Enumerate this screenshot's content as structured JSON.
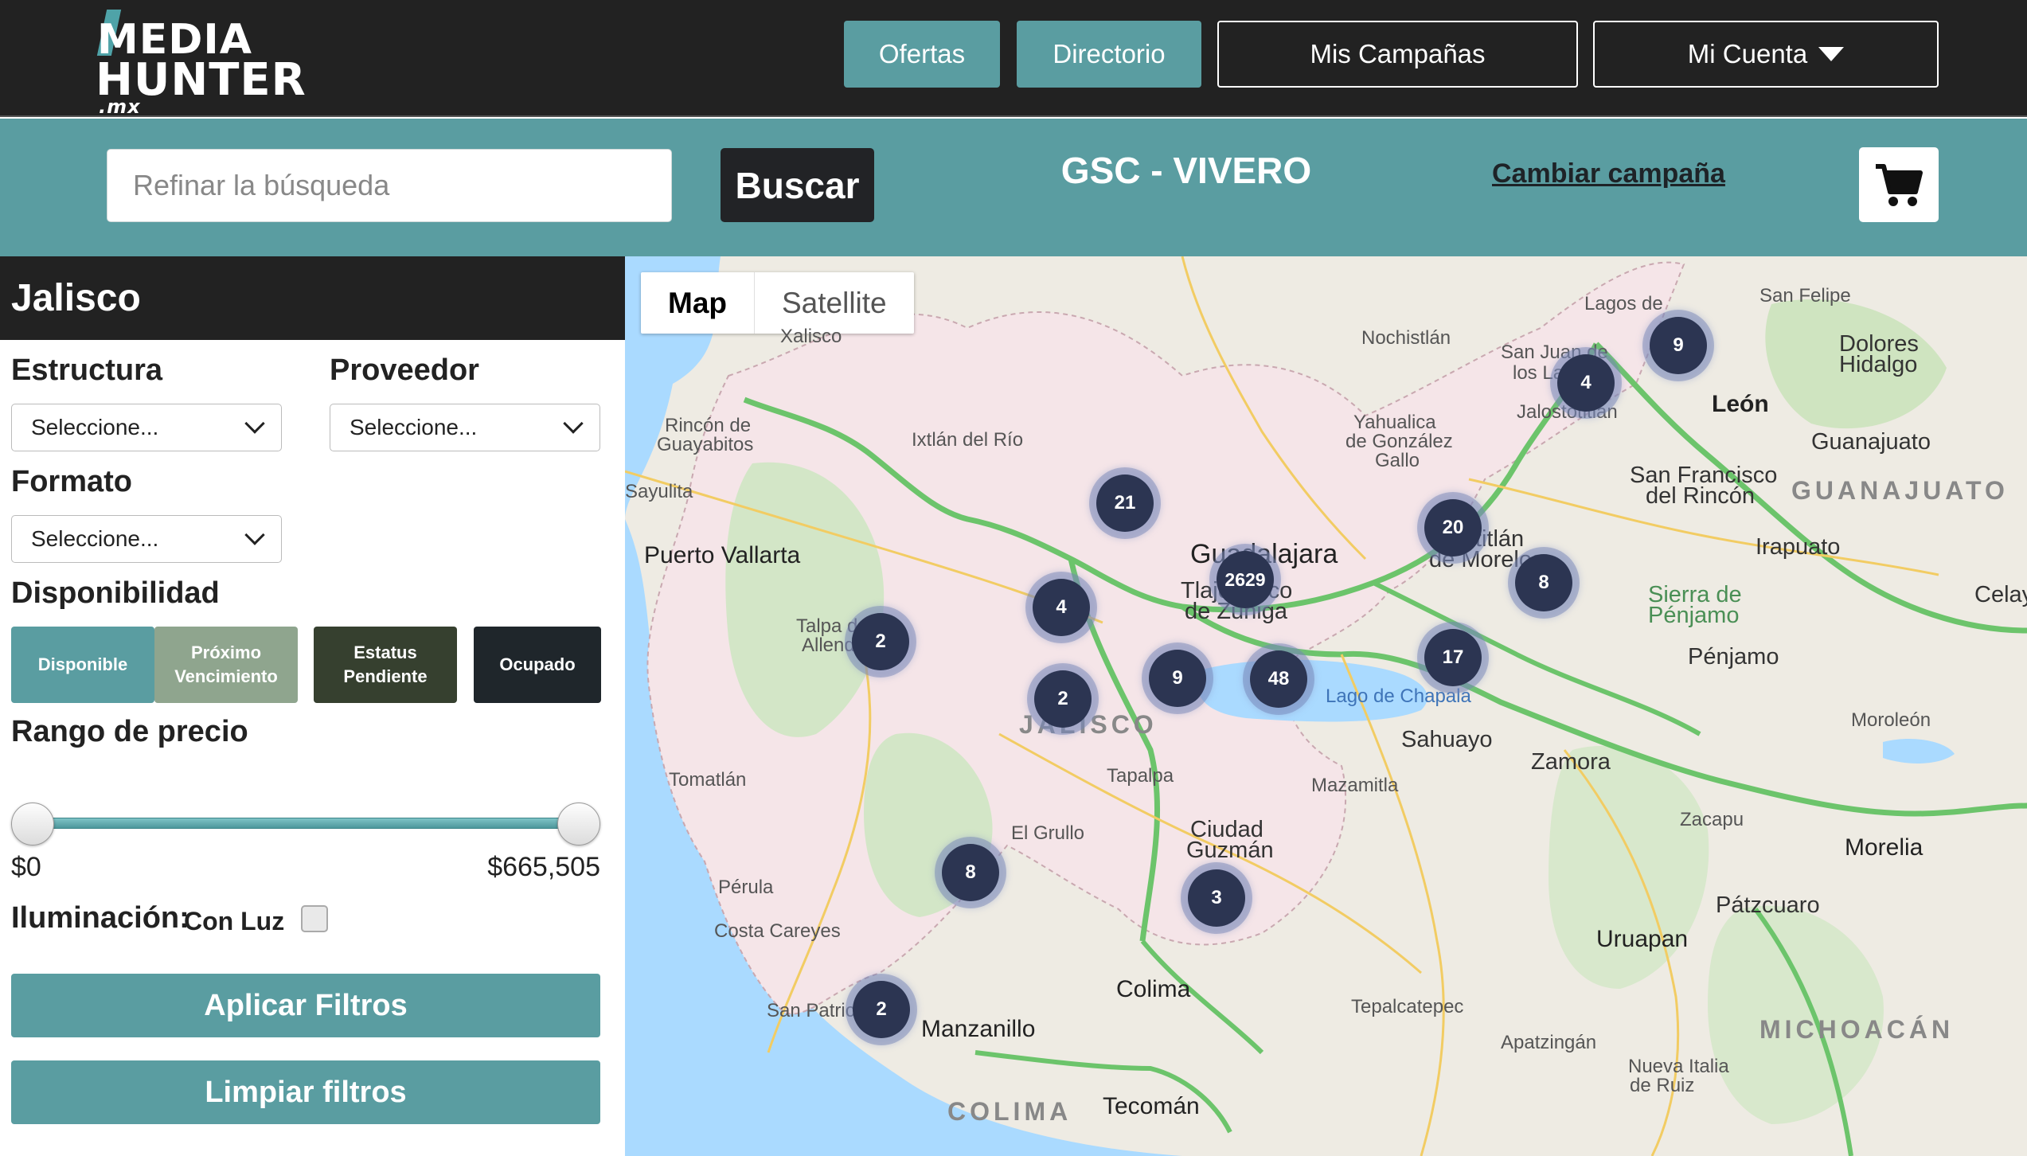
{
  "header": {
    "logo_lines": [
      "MEDIA",
      "HUNTER",
      ".mx"
    ],
    "nav": {
      "ofertas": "Ofertas",
      "directorio": "Directorio",
      "mis_campanas": "Mis Campañas",
      "mi_cuenta": "Mi Cuenta"
    }
  },
  "search": {
    "placeholder": "Refinar la búsqueda",
    "value": "",
    "button": "Buscar",
    "campaign": "GSC - VIVERO",
    "change_campaign": "Cambiar campaña",
    "cart_icon": "shopping-cart-icon"
  },
  "sidebar": {
    "region": "Jalisco",
    "estructura": {
      "label": "Estructura",
      "selected": "Seleccione..."
    },
    "proveedor": {
      "label": "Proveedor",
      "selected": "Seleccione..."
    },
    "formato": {
      "label": "Formato",
      "selected": "Seleccione..."
    },
    "disponibilidad": {
      "label": "Disponibilidad",
      "options": [
        "Disponible",
        "Próximo Vencimiento",
        "Estatus Pendiente",
        "Ocupado"
      ],
      "colors": [
        "#5a9da1",
        "#8fa58e",
        "#36402f",
        "#1f262b"
      ]
    },
    "precio": {
      "label": "Rango de precio",
      "min": "$0",
      "max": "$665,505",
      "range_fraction": [
        0,
        1
      ]
    },
    "iluminacion": {
      "label": "Iluminación:",
      "option": "Con Luz",
      "checked": false
    },
    "apply": "Aplicar Filtros",
    "clear": "Limpiar filtros"
  },
  "map": {
    "type_map": "Map",
    "type_satellite": "Satellite",
    "clusters": [
      "9",
      "4",
      "21",
      "20",
      "8",
      "2629",
      "4",
      "2",
      "9",
      "48",
      "17",
      "2",
      "8",
      "3",
      "2"
    ],
    "labels": {
      "lagos": "Lagos de",
      "san_felipe": "San Felipe",
      "dolores": "Dolores",
      "hidalgo": "Hidalgo",
      "leon": "León",
      "guanajuato": "Guanajuato",
      "guanajuato_state": "GUANAJUATO",
      "nochistlan": "Nochistlán",
      "san_juan": "San Juan de",
      "san_juan2": "los Lagos",
      "jalostotitlan": "Jalostotitlán",
      "yahualica": "Yahualica",
      "yahualica2": "de González",
      "yahualica3": "Gallo",
      "xalisco": "Xalisco",
      "rincon": "Rincón de",
      "rincon2": "Guayabitos",
      "ixtlan": "Ixtlán del Río",
      "sayulita": "Sayulita",
      "san_francisco": "San Francisco",
      "san_francisco2": "del Rincón",
      "guadalajara": "Guadalajara",
      "tepatitlan": "Tepatitlán",
      "tepatitlan2": "de Morelos",
      "irapuato": "Irapuato",
      "celaya": "Celaya",
      "puerto_vallarta": "Puerto Vallarta",
      "tlajomulco": "Tlajomulco",
      "tlajomulco2": "de Zúñiga",
      "sierra": "Sierra de",
      "sierra2": "Pénjamo",
      "talpa": "Talpa de",
      "talpa2": "Allende",
      "penjamo": "Pénjamo",
      "chapala": "Lago de Chapala",
      "moroleon": "Moroleón",
      "jalisco_state": "JALISCO",
      "sahuayo": "Sahuayo",
      "zamora": "Zamora",
      "tomatlan": "Tomatlán",
      "tapalpa": "Tapalpa",
      "mazamitla": "Mazamitla",
      "zacapu": "Zacapu",
      "morelia": "Morelia",
      "el_grullo": "El Grullo",
      "ciudad_guzman": "Ciudad",
      "ciudad_guzman2": "Guzmán",
      "perula": "Pérula",
      "patzcuaro": "Pátzcuaro",
      "costa_careyes": "Costa Careyes",
      "uruapan": "Uruapan",
      "colima": "Colima",
      "tepalcatepec": "Tepalcatepec",
      "michoacan_state": "MICHOACÁN",
      "san_patricio": "San Patricio",
      "manzanillo": "Manzanillo",
      "apatzingan": "Apatzingán",
      "nueva_italia": "Nueva Italia",
      "nueva_italia2": "de Ruiz",
      "colima_state": "COLIMA",
      "tecoman": "Tecomán"
    }
  }
}
